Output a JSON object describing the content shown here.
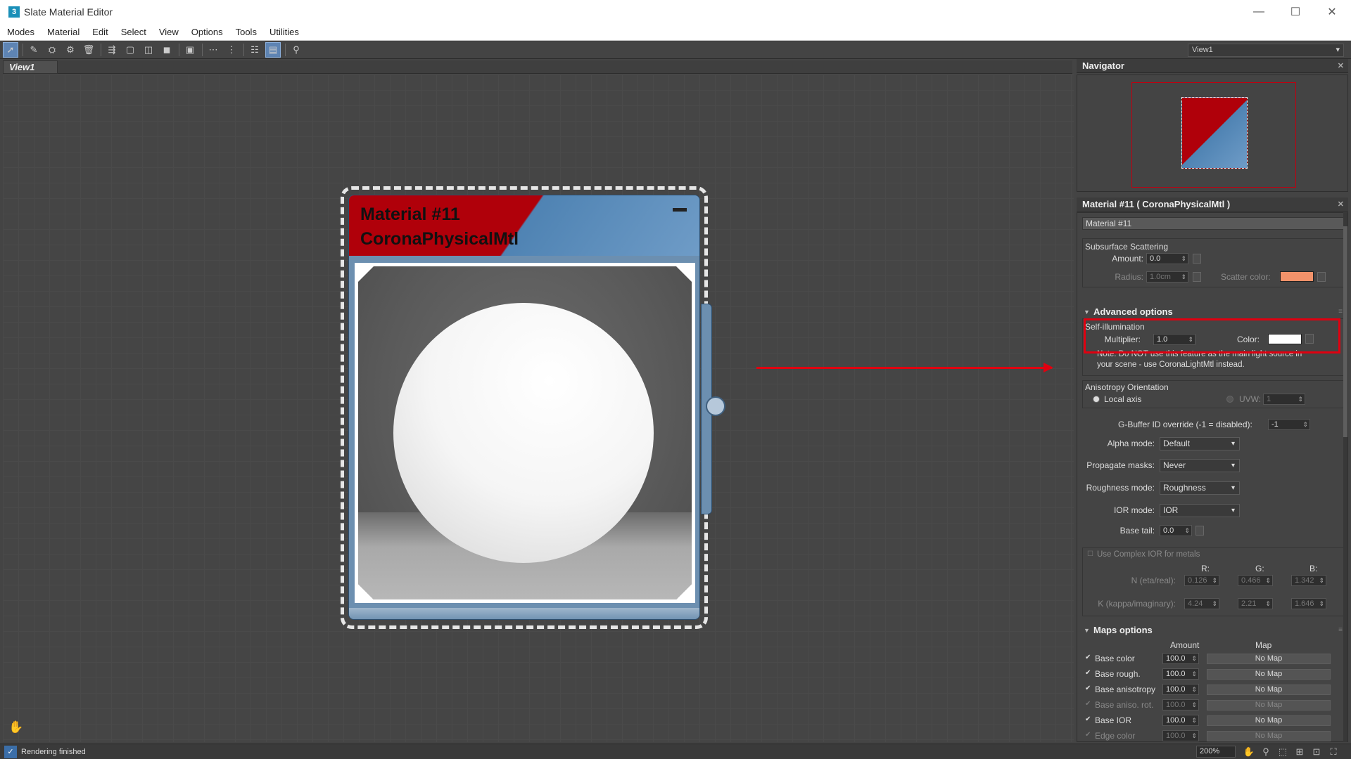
{
  "window": {
    "title": "Slate Material Editor",
    "app_icon": "3"
  },
  "menu": [
    "Modes",
    "Material",
    "Edit",
    "Select",
    "View",
    "Options",
    "Tools",
    "Utilities"
  ],
  "toolbar": {
    "view_select": "View1"
  },
  "view_tab": "View1",
  "node": {
    "title": "Material #11",
    "subtitle": "CoronaPhysicalMtl"
  },
  "navigator": {
    "title": "Navigator"
  },
  "props": {
    "header": "Material #11  ( CoronaPhysicalMtl )",
    "material_name": "Material #11",
    "sss": {
      "title": "Subsurface Scattering",
      "amount_label": "Amount:",
      "amount": "0.0",
      "radius_label": "Radius:",
      "radius": "1.0cm",
      "scatter_label": "Scatter color:",
      "scatter_color": "#f2926a"
    },
    "advanced": {
      "title": "Advanced options",
      "selfillum_label": "Self-illumination",
      "multiplier_label": "Multiplier:",
      "multiplier": "1.0",
      "color_label": "Color:",
      "color": "#ffffff",
      "note1": "Note: Do NOT use this feature as the main light source in",
      "note2": "your scene - use CoronaLightMtl instead.",
      "aniso_title": "Anisotropy Orientation",
      "local_axis": "Local axis",
      "uvw_label": "UVW:",
      "uvw": "1",
      "gbuffer_label": "G-Buffer ID override (-1 = disabled):",
      "gbuffer": "-1",
      "alpha_label": "Alpha mode:",
      "alpha": "Default",
      "propagate_label": "Propagate masks:",
      "propagate": "Never",
      "roughness_label": "Roughness mode:",
      "roughness": "Roughness",
      "ior_label": "IOR mode:",
      "ior": "IOR",
      "basetail_label": "Base tail:",
      "basetail": "0.0",
      "complex_label": "Use Complex IOR for metals",
      "r_label": "R:",
      "g_label": "G:",
      "b_label": "B:",
      "n_label": "N (eta/real):",
      "n_r": "0.126",
      "n_g": "0.466",
      "n_b": "1.342",
      "k_label": "K (kappa/imaginary):",
      "k_r": "4.24",
      "k_g": "2.21",
      "k_b": "1.646"
    },
    "maps": {
      "title": "Maps options",
      "amount_head": "Amount",
      "map_head": "Map",
      "rows": [
        {
          "name": "Base color",
          "amount": "100.0",
          "map": "No Map"
        },
        {
          "name": "Base rough.",
          "amount": "100.0",
          "map": "No Map"
        },
        {
          "name": "Base anisotropy",
          "amount": "100.0",
          "map": "No Map"
        },
        {
          "name": "Base aniso. rot.",
          "amount": "100.0",
          "map": "No Map"
        },
        {
          "name": "Base IOR",
          "amount": "100.0",
          "map": "No Map"
        },
        {
          "name": "Edge color",
          "amount": "100.0",
          "map": "No Map"
        }
      ]
    }
  },
  "status": {
    "text": "Rendering finished",
    "zoom": "200%"
  }
}
